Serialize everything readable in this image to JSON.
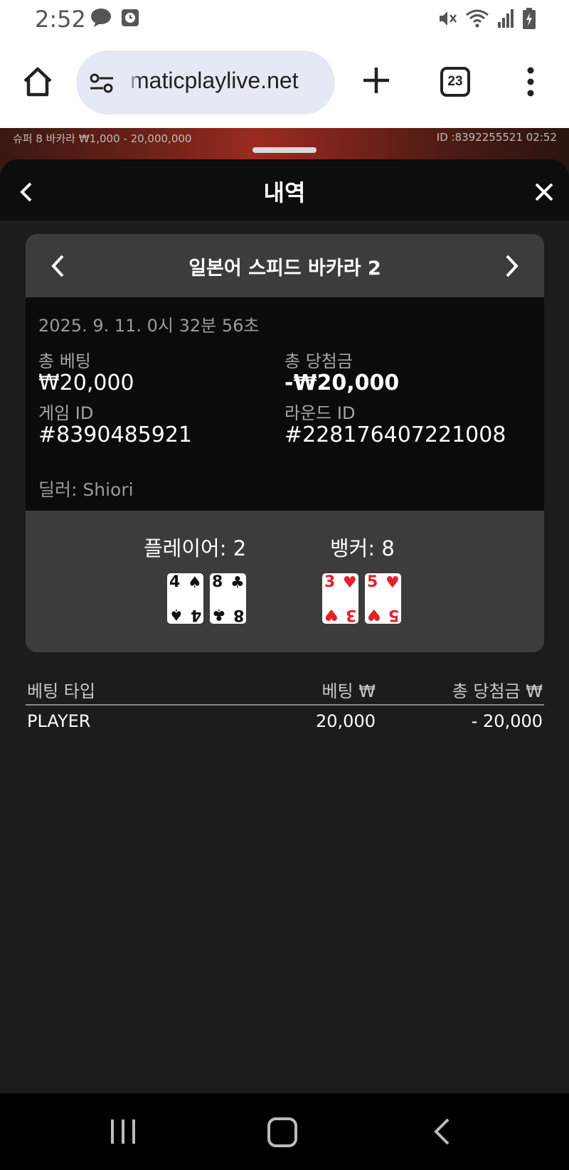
{
  "status_bar": {
    "time": "2:52",
    "left_icons": [
      "chat-bubble-icon",
      "clock-app-icon"
    ],
    "right_icons": [
      "mute-icon",
      "wifi-icon",
      "signal-icon",
      "battery-charging-icon"
    ]
  },
  "browser": {
    "url": "maticplaylive.net",
    "tab_count": "23"
  },
  "game_strip": {
    "info": "슈퍼 8 바카라 ₩1,000 - 20,000,000",
    "id": "ID :8392255521 02:52"
  },
  "sheet": {
    "title": "내역"
  },
  "card": {
    "title": "일본어 스피드 바카라 2",
    "date": "2025. 9. 11. 0시 32분 56초",
    "total_bet_label": "총 베팅",
    "total_bet_value": "₩20,000",
    "total_win_label": "총 당첨금",
    "total_win_value": "-₩20,000",
    "game_id_label": "게임 ID",
    "game_id_value": "#8390485921",
    "round_id_label": "라운드 ID",
    "round_id_value": "#228176407221008",
    "dealer": "딜러: Shiori",
    "player_label": "플레이어: 2",
    "banker_label": "뱅커: 8",
    "player_cards": [
      {
        "rank": "4",
        "suit": "♠",
        "color": "#111111"
      },
      {
        "rank": "8",
        "suit": "♣",
        "color": "#111111"
      }
    ],
    "banker_cards": [
      {
        "rank": "3",
        "suit": "♥",
        "color": "#e5202a"
      },
      {
        "rank": "5",
        "suit": "♥",
        "color": "#e5202a"
      }
    ]
  },
  "bets": {
    "headers": [
      "베팅 타입",
      "베팅 ₩",
      "총 당첨금 ₩"
    ],
    "rows": [
      {
        "type": "PLAYER",
        "bet": "20,000",
        "win": "- 20,000"
      }
    ]
  }
}
